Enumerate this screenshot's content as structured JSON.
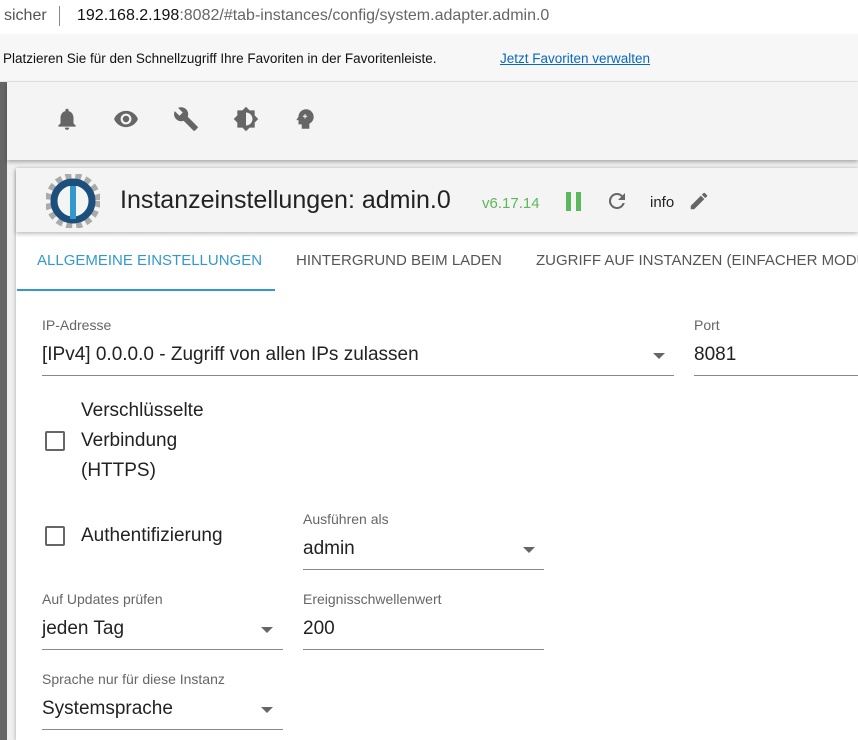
{
  "browser": {
    "security": "sicher",
    "url_host": "192.168.2.198",
    "url_rest": ":8082/#tab-instances/config/system.adapter.admin.0",
    "fav_message": "Platzieren Sie für den Schnellzugriff Ihre Favoriten in der Favoritenleiste.",
    "fav_link": "Jetzt Favoriten verwalten"
  },
  "header": {
    "title": "Instanzeinstellungen: admin.0",
    "version": "v6.17.14",
    "info": "info"
  },
  "tabs": [
    "ALLGEMEINE EINSTELLUNGEN",
    "HINTERGRUND BEIM LADEN",
    "ZUGRIFF AUF INSTANZEN (EINFACHER MODUS)"
  ],
  "form": {
    "ip": {
      "label": "IP-Adresse",
      "value": "[IPv4] 0.0.0.0 - Zugriff von allen IPs zulassen"
    },
    "port": {
      "label": "Port",
      "value": "8081"
    },
    "https": {
      "label1": "Verschlüsselte",
      "label2": "Verbindung",
      "label3": "(HTTPS)",
      "checked": false
    },
    "auth": {
      "label": "Authentifizierung",
      "checked": false
    },
    "run_as": {
      "label": "Ausführen als",
      "value": "admin"
    },
    "updates": {
      "label": "Auf Updates prüfen",
      "value": "jeden Tag"
    },
    "threshold": {
      "label": "Ereignisschwellenwert",
      "value": "200"
    },
    "language": {
      "label": "Sprache nur für diese Instanz",
      "value": "Systemsprache"
    }
  },
  "colors": {
    "accent": "#3399cc",
    "version": "#5cb85c",
    "pause": "#5cb85c"
  }
}
